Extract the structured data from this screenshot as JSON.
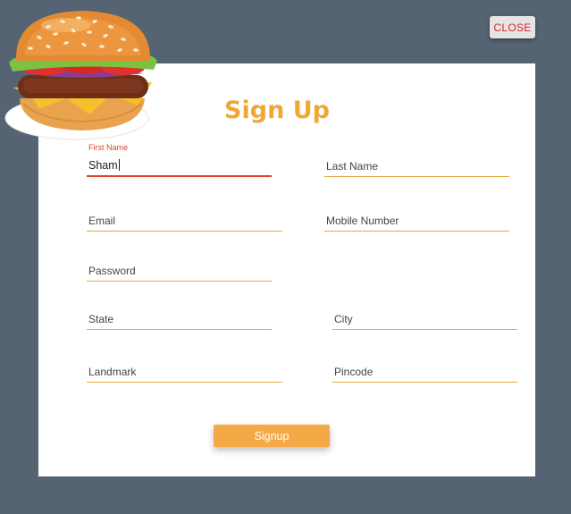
{
  "dialog": {
    "close_label": "CLOSE",
    "title": "Sign Up"
  },
  "form": {
    "first_name": {
      "floating_label": "First Name",
      "value": "Sham"
    },
    "last_name": {
      "label": "Last Name"
    },
    "email": {
      "label": "Email"
    },
    "mobile": {
      "label": "Mobile Number"
    },
    "password": {
      "label": "Password"
    },
    "state": {
      "label": "State"
    },
    "city": {
      "label": "City"
    },
    "landmark": {
      "label": "Landmark"
    },
    "pincode": {
      "label": "Pincode"
    }
  },
  "actions": {
    "signup_label": "Signup"
  },
  "colors": {
    "backdrop": "#566373",
    "accent": "#f0a733",
    "active_underline": "#e2432a",
    "close_text": "#e02424"
  },
  "icons": {
    "hero": "burger-illustration"
  }
}
